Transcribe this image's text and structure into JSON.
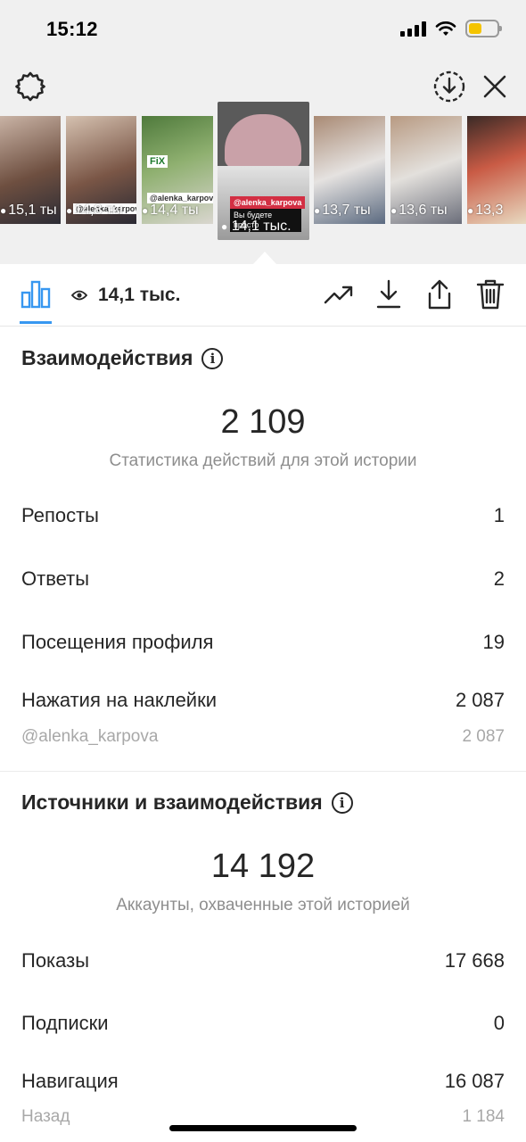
{
  "status_bar": {
    "time": "15:12"
  },
  "colors": {
    "accent": "#3797f0",
    "text": "#262626",
    "muted": "#8e8e8e",
    "battery": "#f5c400"
  },
  "top_bar": {
    "left_icon": "settings-gear-icon",
    "right_icons": [
      "download-circle-icon",
      "close-icon"
    ]
  },
  "stories": [
    {
      "views": "15,1 ты"
    },
    {
      "views": "14,8 ты",
      "tag": "@alenka_karpova"
    },
    {
      "views": "14,4 ты",
      "tag": "@alenka_karpova",
      "badge": "FiX"
    },
    {
      "views": "14,1 тыс.",
      "tag": "@alenka_karpova",
      "caption": "Вы будете просто"
    },
    {
      "views": "13,7 ты"
    },
    {
      "views": "13,6 ты"
    },
    {
      "views": "13,3"
    }
  ],
  "toolbar": {
    "views": "14,1 тыс.",
    "icons": [
      "bar-chart-icon",
      "eye-icon",
      "trending-icon",
      "download-icon",
      "share-icon",
      "trash-icon"
    ]
  },
  "interactions": {
    "title": "Взаимодействия",
    "total": "2 109",
    "caption": "Статистика действий для этой истории",
    "rows": [
      {
        "label": "Репосты",
        "value": "1"
      },
      {
        "label": "Ответы",
        "value": "2"
      },
      {
        "label": "Посещения профиля",
        "value": "19"
      },
      {
        "label": "Нажатия на наклейки",
        "value": "2 087"
      }
    ],
    "sub_row": {
      "label": "@alenka_karpova",
      "value": "2 087"
    }
  },
  "discovery": {
    "title": "Источники и взаимодействия",
    "total": "14 192",
    "caption": "Аккаунты, охваченные этой историей",
    "rows": [
      {
        "label": "Показы",
        "value": "17 668"
      },
      {
        "label": "Подписки",
        "value": "0"
      },
      {
        "label": "Навигация",
        "value": "16 087"
      }
    ],
    "sub_row": {
      "label": "Назад",
      "value": "1 184"
    }
  }
}
